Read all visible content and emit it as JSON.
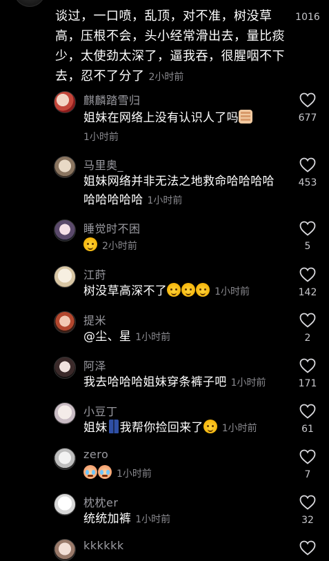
{
  "top_comment": {
    "text": "谈过，一口喷，乱顶，对不准，树没草高，压根不会，头小经常滑出去，量比痰少，太使劲太深了，逼我吞，很腥咽不下去，忍不了分了",
    "time": "2小时前",
    "likes": "1016"
  },
  "replies": [
    {
      "username": "麒麟踏雪归",
      "text": "姐妹在网络上没有认识人了吗",
      "emoji_after": [
        "hand-icon"
      ],
      "time": "1小时前",
      "likes": "677"
    },
    {
      "username": "马里奥_",
      "text": "姐妹网络并非无法之地救命哈哈哈哈哈哈哈哈哈",
      "time": "1小时前",
      "likes": "453"
    },
    {
      "username": "睡觉时不困",
      "text": "",
      "emoji_after": [
        "grin-icon"
      ],
      "time": "2小时前",
      "likes": "5"
    },
    {
      "username": "江莳",
      "text": "树没草高深不了",
      "emoji_after": [
        "grin-icon",
        "grin-icon",
        "grin-icon"
      ],
      "time": "1小时前",
      "likes": "142"
    },
    {
      "username": "提米",
      "text": "@尘、星",
      "time": "1小时前",
      "likes": "2"
    },
    {
      "username": "阿泽",
      "text": "我去哈哈哈姐妹穿条裤子吧",
      "time": "1小时前",
      "likes": "171"
    },
    {
      "username": "小豆丁",
      "text_before": "姐妹",
      "text": "我帮你捡回来了",
      "emoji_after": [
        "grin-icon"
      ],
      "time": "1小时前",
      "likes": "61"
    },
    {
      "username": "zero",
      "text": "",
      "emoji_after": [
        "cry-icon",
        "cry-icon"
      ],
      "time": "1小时前",
      "likes": "7"
    },
    {
      "username": "枕枕er",
      "text": "统统加裤",
      "time": "1小时前",
      "likes": "32"
    },
    {
      "username": "kkkkkk",
      "text": "",
      "time": "",
      "likes": ""
    }
  ],
  "colors": {
    "background": "#000000",
    "text": "#ffffff",
    "secondary": "#8a8a8f"
  }
}
